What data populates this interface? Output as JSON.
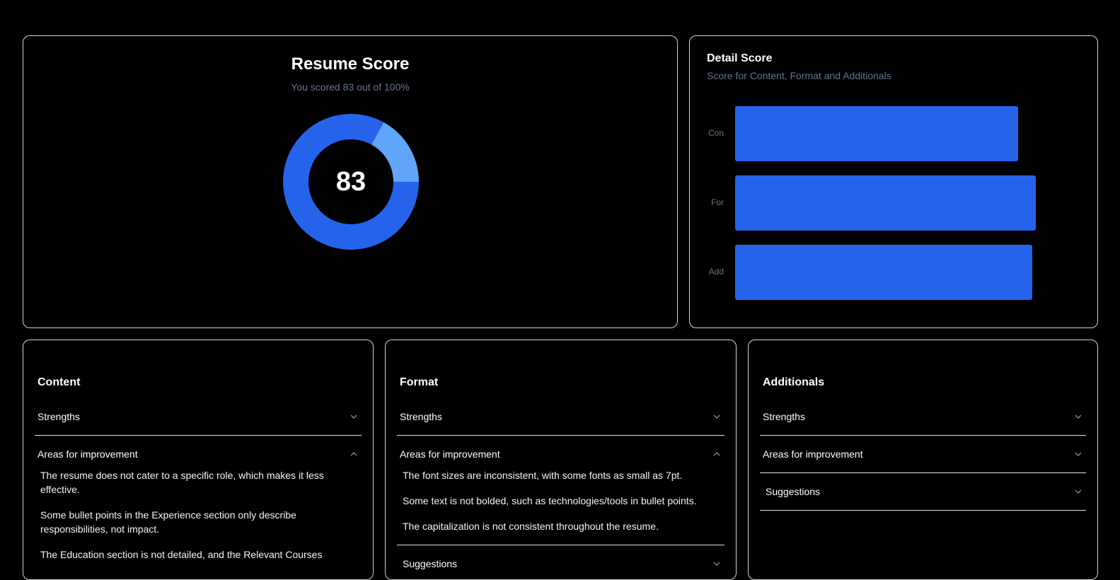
{
  "score_card": {
    "title": "Resume Score",
    "subtitle": "You scored 83 out of 100%",
    "score": "83",
    "score_value": 83,
    "colors": {
      "primary": "#2563eb",
      "secondary": "#60a5fa"
    }
  },
  "detail_card": {
    "title": "Detail Score",
    "subtitle": "Score for Content, Format and Additionals"
  },
  "chart_data": {
    "type": "bar",
    "orientation": "horizontal",
    "categories": [
      "Con",
      "For",
      "Add"
    ],
    "values": [
      80,
      85,
      84
    ],
    "xlim": [
      0,
      100
    ],
    "grid": false,
    "color": "#2563eb"
  },
  "content_section": {
    "title": "Content",
    "strengths_label": "Strengths",
    "improvement_label": "Areas for improvement",
    "improvements": [
      "The resume does not cater to a specific role, which makes it less effective.",
      "Some bullet points in the Experience section only describe responsibilities, not impact.",
      "The Education section is not detailed, and the Relevant Courses"
    ]
  },
  "format_section": {
    "title": "Format",
    "strengths_label": "Strengths",
    "improvement_label": "Areas for improvement",
    "improvements": [
      "The font sizes are inconsistent, with some fonts as small as 7pt.",
      "Some text is not bolded, such as technologies/tools in bullet points.",
      "The capitalization is not consistent throughout the resume."
    ],
    "suggestions_label": "Suggestions"
  },
  "additionals_section": {
    "title": "Additionals",
    "strengths_label": "Strengths",
    "improvement_label": "Areas for improvement",
    "suggestions_label": "Suggestions"
  },
  "icons": {
    "expand": "chevron-down-icon",
    "collapse": "chevron-up-icon"
  }
}
